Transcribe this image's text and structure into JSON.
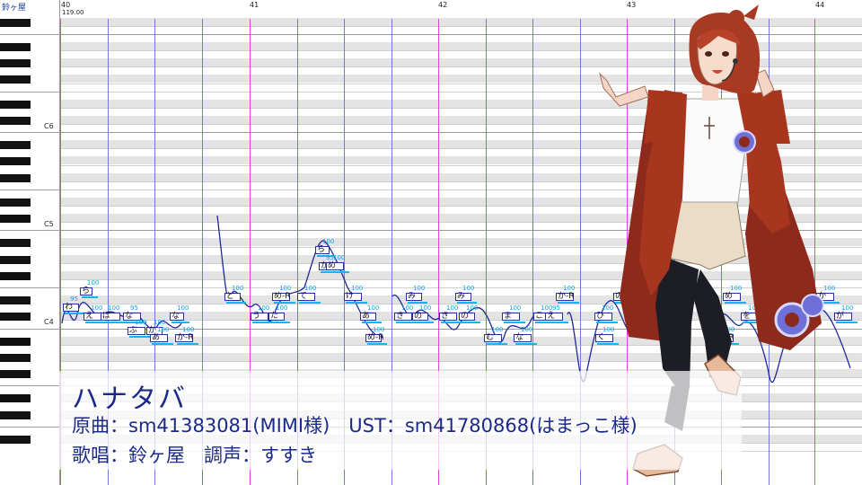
{
  "track": {
    "singer_label": "鈴ヶ屋"
  },
  "ruler": {
    "measures": [
      "40",
      "41",
      "42",
      "43",
      "44"
    ],
    "tempo": "119.00"
  },
  "keyboard": {
    "octave_labels": [
      "C6",
      "C5",
      "C4"
    ]
  },
  "notes": [
    {
      "lyric": "わ",
      "vel": "95"
    },
    {
      "lyric": "ら",
      "vel": "100"
    },
    {
      "lyric": "え",
      "vel": "100"
    },
    {
      "lyric": "ば",
      "vel": "100"
    },
    {
      "lyric": "な",
      "vel": "95"
    },
    {
      "lyric": "ぶ",
      "vel": "100"
    },
    {
      "lyric": "か",
      "vel": "100"
    },
    {
      "lyric": "な",
      "vel": "100"
    },
    {
      "lyric": "あ",
      "vel": "100"
    },
    {
      "lyric": "か-R",
      "vel": "100"
    },
    {
      "lyric": "ど",
      "vel": "100"
    },
    {
      "lyric": "う",
      "vel": "100"
    },
    {
      "lyric": "め-R",
      "vel": "100"
    },
    {
      "lyric": "た",
      "vel": "100"
    },
    {
      "lyric": "て",
      "vel": "100"
    },
    {
      "lyric": "ら",
      "vel": "100"
    },
    {
      "lyric": "か",
      "vel": "95"
    },
    {
      "lyric": "め",
      "vel": "100"
    },
    {
      "lyric": "け",
      "vel": "100"
    },
    {
      "lyric": "あ",
      "vel": "100"
    },
    {
      "lyric": "め-R",
      "vel": "100"
    },
    {
      "lyric": "み",
      "vel": "100"
    },
    {
      "lyric": "き",
      "vel": "100"
    },
    {
      "lyric": "の",
      "vel": "100"
    },
    {
      "lyric": "み",
      "vel": "100"
    },
    {
      "lyric": "き",
      "vel": "100"
    },
    {
      "lyric": "の",
      "vel": "100"
    },
    {
      "lyric": "む",
      "vel": "100"
    },
    {
      "lyric": "ま",
      "vel": "100"
    },
    {
      "lyric": "な",
      "vel": "100"
    },
    {
      "lyric": "こ",
      "vel": "100"
    },
    {
      "lyric": "え",
      "vel": "95"
    },
    {
      "lyric": "か-R",
      "vel": "100"
    },
    {
      "lyric": "ひ",
      "vel": "100"
    },
    {
      "lyric": "く",
      "vel": "100"
    },
    {
      "lyric": "の",
      "vel": "100"
    },
    {
      "lyric": "め",
      "vel": "100"
    },
    {
      "lyric": "く-R",
      "vel": "100"
    },
    {
      "lyric": "を",
      "vel": "100"
    },
    {
      "lyric": "か",
      "vel": "100"
    },
    {
      "lyric": "が",
      "vel": "100"
    }
  ],
  "overlay": {
    "title": "ハナタバ",
    "credit_line1": "原曲：sm41383081(MIMI様)　UST：sm41780868(はまっこ様)",
    "credit_line2": "歌唱：鈴ヶ屋　調声：すすき"
  },
  "colors": {
    "bar_line": "#dd44dd",
    "beat_line": "#6f7ae0",
    "note_border": "#2a2f9f",
    "pitch_curve": "#1e2a9a",
    "velocity": "#12a4d8",
    "overlay_text": "#1b2a88"
  },
  "icons": {
    "character": "character-illustration"
  }
}
